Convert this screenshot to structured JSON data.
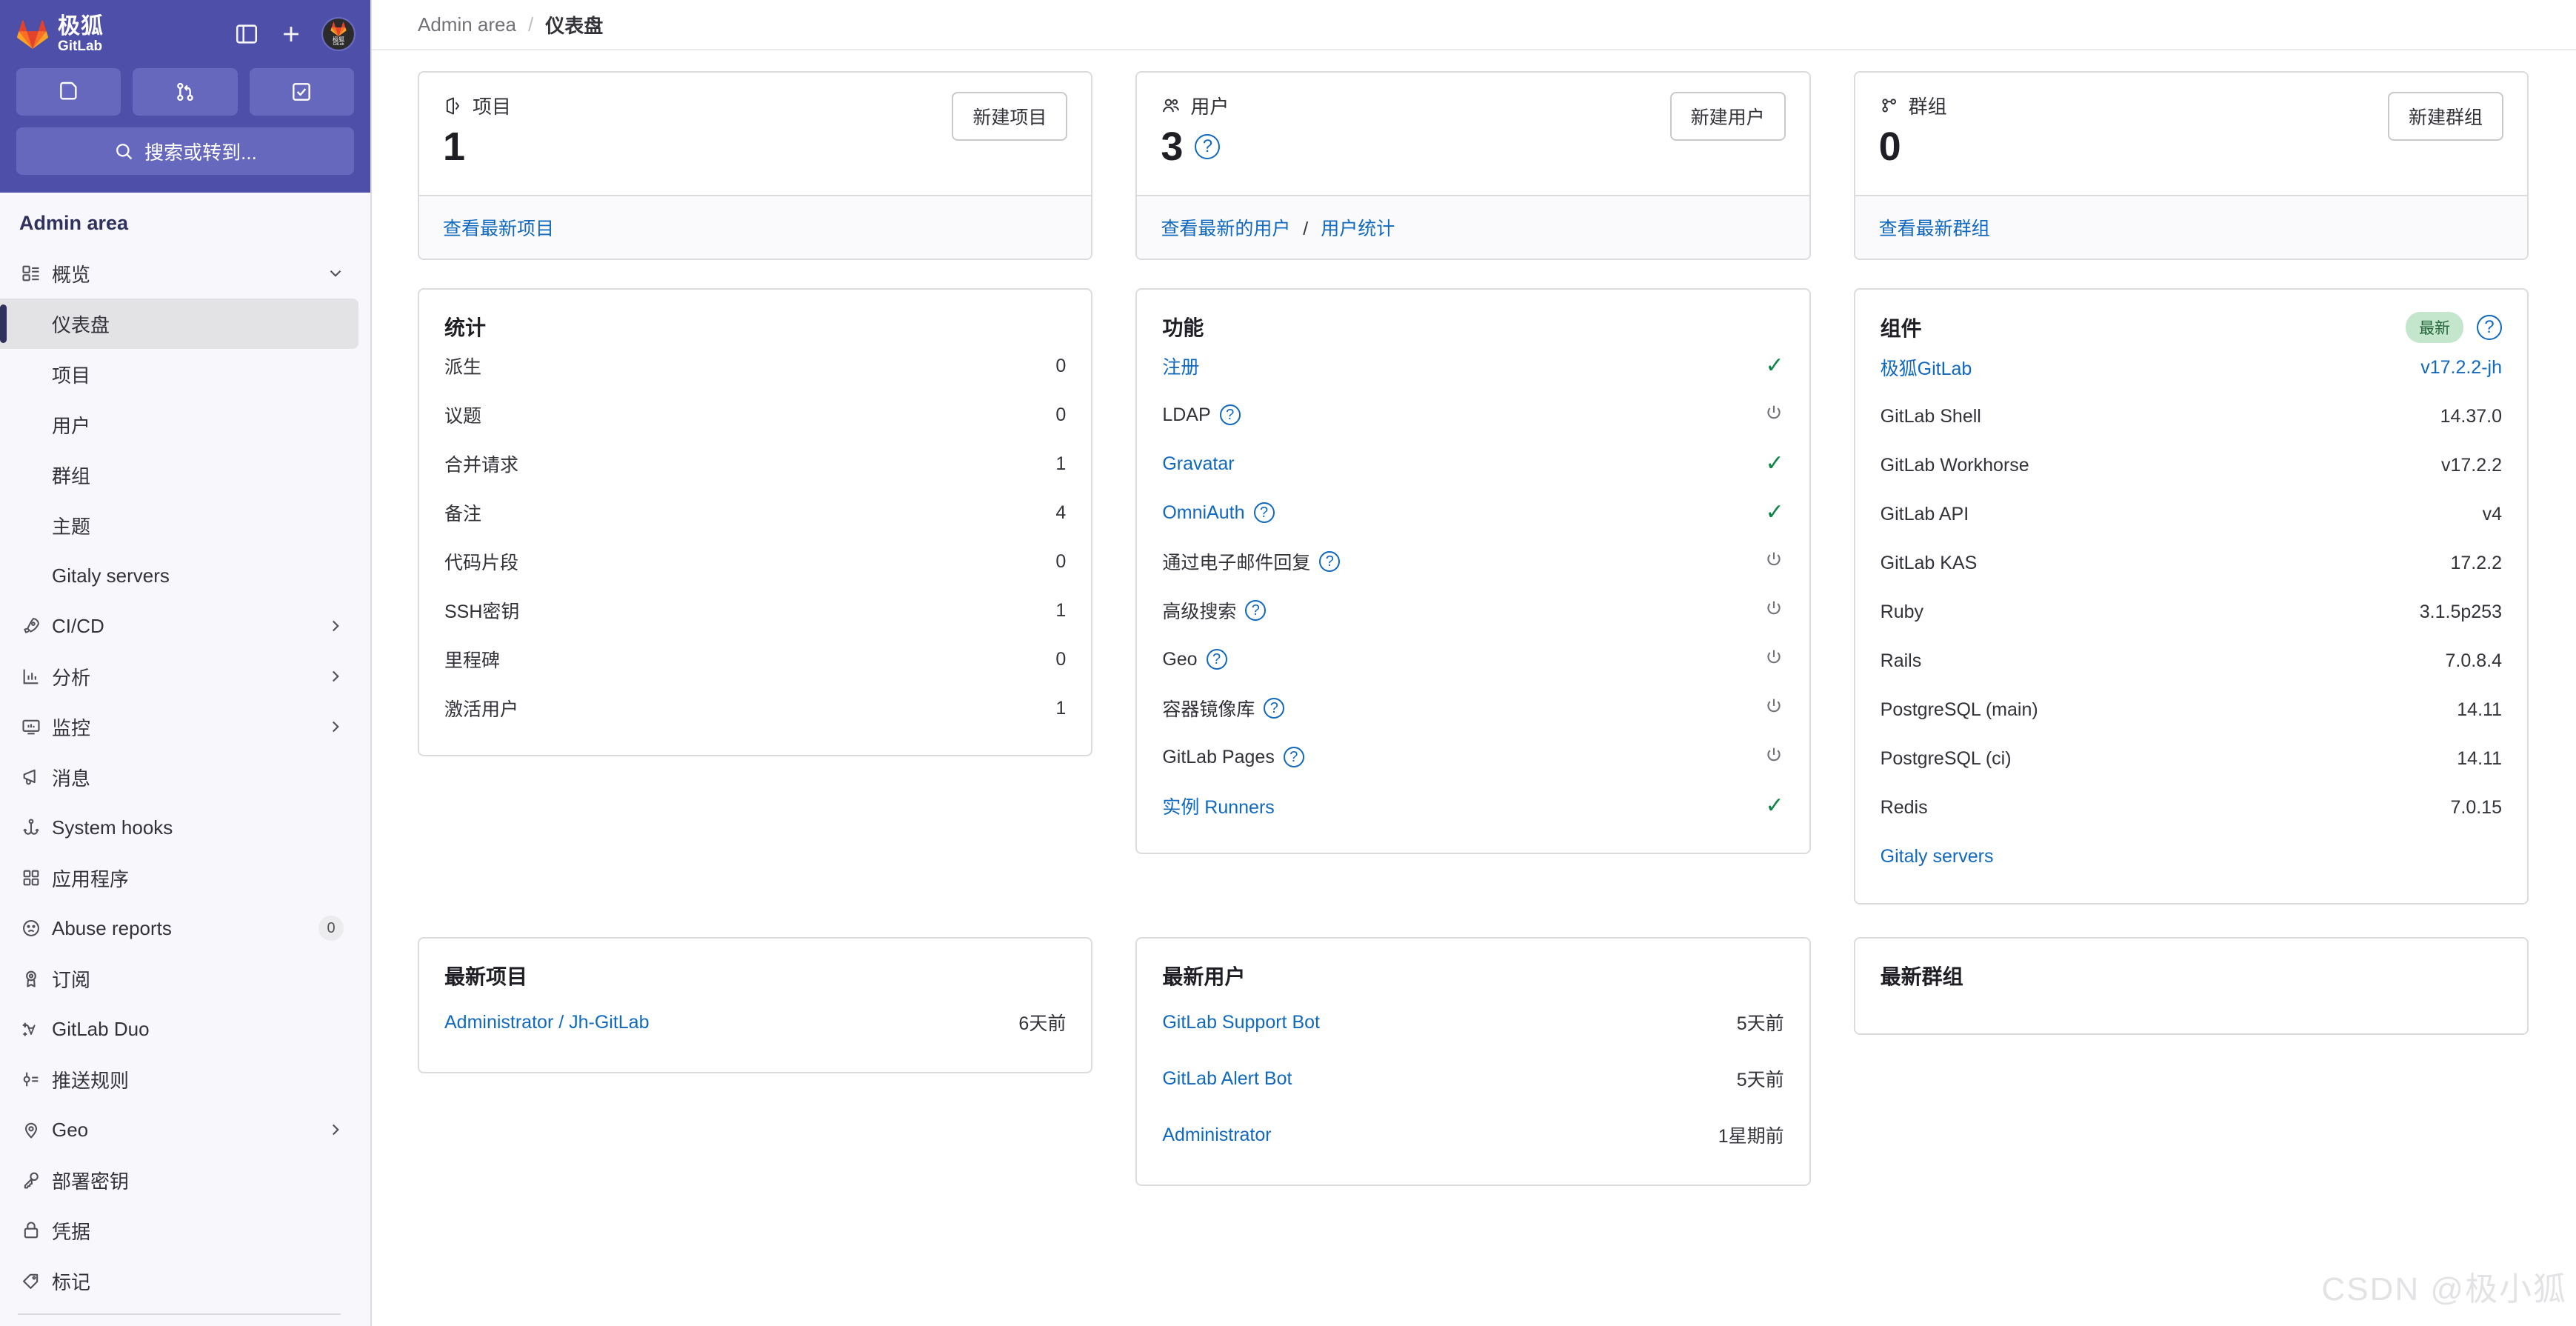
{
  "brand": {
    "cn": "极狐",
    "en": "GitLab"
  },
  "topbar": {
    "sidebar_toggle_icon": "panel-toggle-icon",
    "create_icon": "plus-icon",
    "avatar_alt": "极狐",
    "actions": [
      {
        "name": "issues-shortcut",
        "icon": "issue-icon"
      },
      {
        "name": "merge-requests-shortcut",
        "icon": "merge-request-icon"
      },
      {
        "name": "todos-shortcut",
        "icon": "todo-check-icon"
      }
    ],
    "search_placeholder": "搜索或转到...",
    "search_icon": "search-icon"
  },
  "sidebar": {
    "title": "Admin area",
    "items": [
      {
        "label": "概览",
        "icon": "overview-icon",
        "type": "group",
        "chevron": "down",
        "active": false
      },
      {
        "label": "仪表盘",
        "icon": "",
        "type": "sub",
        "active": true
      },
      {
        "label": "项目",
        "icon": "",
        "type": "sub",
        "active": false
      },
      {
        "label": "用户",
        "icon": "",
        "type": "sub",
        "active": false
      },
      {
        "label": "群组",
        "icon": "",
        "type": "sub",
        "active": false
      },
      {
        "label": "主题",
        "icon": "",
        "type": "sub",
        "active": false
      },
      {
        "label": "Gitaly servers",
        "icon": "",
        "type": "sub",
        "active": false
      },
      {
        "label": "CI/CD",
        "icon": "rocket-icon",
        "type": "group",
        "chevron": "right",
        "active": false
      },
      {
        "label": "分析",
        "icon": "chart-icon",
        "type": "group",
        "chevron": "right",
        "active": false
      },
      {
        "label": "监控",
        "icon": "monitor-icon",
        "type": "group",
        "chevron": "right",
        "active": false
      },
      {
        "label": "消息",
        "icon": "megaphone-icon",
        "type": "item",
        "active": false
      },
      {
        "label": "System hooks",
        "icon": "hook-icon",
        "type": "item",
        "active": false
      },
      {
        "label": "应用程序",
        "icon": "applications-icon",
        "type": "item",
        "active": false
      },
      {
        "label": "Abuse reports",
        "icon": "frown-icon",
        "type": "item",
        "badge": "0",
        "active": false
      },
      {
        "label": "订阅",
        "icon": "license-icon",
        "type": "item",
        "active": false
      },
      {
        "label": "GitLab Duo",
        "icon": "duo-icon",
        "type": "item",
        "active": false
      },
      {
        "label": "推送规则",
        "icon": "push-rules-icon",
        "type": "item",
        "active": false
      },
      {
        "label": "Geo",
        "icon": "location-icon",
        "type": "group",
        "chevron": "right",
        "active": false
      },
      {
        "label": "部署密钥",
        "icon": "key-icon",
        "type": "item",
        "active": false
      },
      {
        "label": "凭据",
        "icon": "lock-icon",
        "type": "item",
        "active": false
      },
      {
        "label": "标记",
        "icon": "label-icon",
        "type": "item",
        "active": false
      }
    ]
  },
  "breadcrumb": {
    "root": "Admin area",
    "separator": "/",
    "current": "仪表盘"
  },
  "stat_cards": [
    {
      "icon": "project-icon",
      "label": "项目",
      "value": "1",
      "has_help": false,
      "button": "新建项目",
      "links": [
        {
          "text": "查看最新项目"
        }
      ]
    },
    {
      "icon": "users-icon",
      "label": "用户",
      "value": "3",
      "has_help": true,
      "button": "新建用户",
      "links": [
        {
          "text": "查看最新的用户"
        },
        {
          "text": "用户统计"
        }
      ]
    },
    {
      "icon": "group-icon",
      "label": "群组",
      "value": "0",
      "has_help": false,
      "button": "新建群组",
      "links": [
        {
          "text": "查看最新群组"
        }
      ]
    }
  ],
  "statistics": {
    "title": "统计",
    "rows": [
      {
        "label": "派生",
        "value": "0"
      },
      {
        "label": "议题",
        "value": "0"
      },
      {
        "label": "合并请求",
        "value": "1"
      },
      {
        "label": "备注",
        "value": "4"
      },
      {
        "label": "代码片段",
        "value": "0"
      },
      {
        "label": "SSH密钥",
        "value": "1"
      },
      {
        "label": "里程碑",
        "value": "0"
      },
      {
        "label": "激活用户",
        "value": "1"
      }
    ]
  },
  "features": {
    "title": "功能",
    "rows": [
      {
        "label": "注册",
        "link": true,
        "help": false,
        "status": "on"
      },
      {
        "label": "LDAP",
        "link": false,
        "help": true,
        "status": "off"
      },
      {
        "label": "Gravatar",
        "link": true,
        "help": false,
        "status": "on"
      },
      {
        "label": "OmniAuth",
        "link": true,
        "help": true,
        "status": "on"
      },
      {
        "label": "通过电子邮件回复",
        "link": false,
        "help": true,
        "status": "off"
      },
      {
        "label": "高级搜索",
        "link": false,
        "help": true,
        "status": "off"
      },
      {
        "label": "Geo",
        "link": false,
        "help": true,
        "status": "off"
      },
      {
        "label": "容器镜像库",
        "link": false,
        "help": true,
        "status": "off"
      },
      {
        "label": "GitLab Pages",
        "link": false,
        "help": true,
        "status": "off"
      },
      {
        "label": "实例 Runners",
        "link": true,
        "help": false,
        "status": "on"
      }
    ]
  },
  "components": {
    "title": "组件",
    "badge": "最新",
    "rows": [
      {
        "label": "极狐GitLab",
        "value": "v17.2.2-jh",
        "link": true
      },
      {
        "label": "GitLab Shell",
        "value": "14.37.0",
        "link": false
      },
      {
        "label": "GitLab Workhorse",
        "value": "v17.2.2",
        "link": false
      },
      {
        "label": "GitLab API",
        "value": "v4",
        "link": false
      },
      {
        "label": "GitLab KAS",
        "value": "17.2.2",
        "link": false
      },
      {
        "label": "Ruby",
        "value": "3.1.5p253",
        "link": false
      },
      {
        "label": "Rails",
        "value": "7.0.8.4",
        "link": false
      },
      {
        "label": "PostgreSQL (main)",
        "value": "14.11",
        "link": false
      },
      {
        "label": "PostgreSQL (ci)",
        "value": "14.11",
        "link": false
      },
      {
        "label": "Redis",
        "value": "7.0.15",
        "link": false
      }
    ],
    "footer_link": "Gitaly servers"
  },
  "latest_projects": {
    "title": "最新项目",
    "rows": [
      {
        "name": "Administrator / Jh-GitLab",
        "when": "6天前"
      }
    ]
  },
  "latest_users": {
    "title": "最新用户",
    "rows": [
      {
        "name": "GitLab Support Bot",
        "when": "5天前"
      },
      {
        "name": "GitLab Alert Bot",
        "when": "5天前"
      },
      {
        "name": "Administrator",
        "when": "1星期前"
      }
    ]
  },
  "latest_groups": {
    "title": "最新群组",
    "rows": []
  },
  "watermark": "CSDN @极小狐",
  "colors": {
    "brand_purple": "#4e4fa8",
    "link_blue": "#1068bf",
    "success_green": "#108548",
    "badge_green_bg": "#c3e6cd",
    "badge_green_fg": "#24663b",
    "sidebar_bg": "#f7f7fc"
  }
}
